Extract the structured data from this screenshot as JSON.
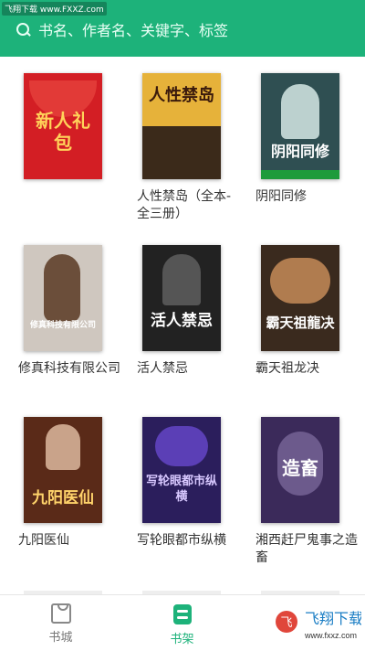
{
  "watermark_top": "飞翔下载 www.FXXZ.com",
  "search": {
    "placeholder": "书名、作者名、关键字、标签"
  },
  "books": [
    {
      "label": "",
      "cover_text": "新人礼包",
      "bg": "#d31e24",
      "fg": "#ffd35a"
    },
    {
      "label": "人性禁岛（全本-全三册）",
      "cover_text": "人性禁岛",
      "bg": "#e6b23a",
      "fg": "#3a1a0c"
    },
    {
      "label": "阴阳同修",
      "cover_text": "阴阳同修",
      "bg": "#2f4f52",
      "fg": "#ffffff"
    },
    {
      "label": "修真科技有限公司",
      "cover_text": "修真科技有限公司",
      "bg": "#cfc7bf",
      "fg": "#ffffff"
    },
    {
      "label": "活人禁忌",
      "cover_text": "活人禁忌",
      "bg": "#222222",
      "fg": "#ffffff"
    },
    {
      "label": "霸天祖龙决",
      "cover_text": "霸天祖龍决",
      "bg": "#3a2a1e",
      "fg": "#ffffff"
    },
    {
      "label": "九阳医仙",
      "cover_text": "九阳医仙",
      "bg": "#5a2a18",
      "fg": "#ffd36a"
    },
    {
      "label": "写轮眼都市纵横",
      "cover_text": "写轮眼都市纵横",
      "bg": "#2b1e5c",
      "fg": "#d8c8ff"
    },
    {
      "label": "湘西赶尸鬼事之造畜",
      "cover_text": "造畜",
      "bg": "#3b2a5a",
      "fg": "#ffffff"
    }
  ],
  "tabs": [
    {
      "label": "书城",
      "color": "#777777"
    },
    {
      "label": "书架",
      "color": "#1db27a"
    }
  ],
  "watermark_bottom": "飞翔下载 www.fxxz.com"
}
